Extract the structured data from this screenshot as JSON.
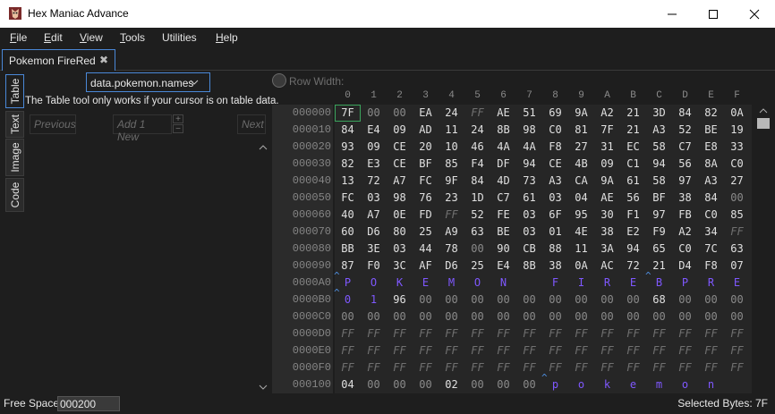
{
  "window": {
    "title": "Hex Maniac Advance",
    "minimize_icon": "minimize-icon",
    "maximize_icon": "maximize-icon",
    "close_icon": "close-icon"
  },
  "menu": [
    "File",
    "Edit",
    "View",
    "Tools",
    "Utilities",
    "Help"
  ],
  "document_tab": {
    "label": "Pokemon FireRed",
    "close": "✖"
  },
  "side_tabs": [
    "Table",
    "Text",
    "Image",
    "Code"
  ],
  "table_tool": {
    "selected_table": "data.pokemon.names",
    "info": "The Table tool only works if your cursor is on table data.",
    "previous_label": "Previous",
    "add_label": "Add",
    "add_count": "1",
    "new_label": "New",
    "plus": "+",
    "minus": "−",
    "next_label": "Next"
  },
  "row_width_label": "Row Width:",
  "column_headers": [
    "0",
    "1",
    "2",
    "3",
    "4",
    "5",
    "6",
    "7",
    "8",
    "9",
    "A",
    "B",
    "C",
    "D",
    "E",
    "F"
  ],
  "addresses": [
    "000000",
    "000010",
    "000020",
    "000030",
    "000040",
    "000050",
    "000060",
    "000070",
    "000080",
    "000090",
    "0000A0",
    "0000B0",
    "0000C0",
    "0000D0",
    "0000E0",
    "0000F0",
    "000100"
  ],
  "hex_rows": [
    [
      "7F",
      "00",
      "00",
      "EA",
      "24",
      "FF",
      "AE",
      "51",
      "69",
      "9A",
      "A2",
      "21",
      "3D",
      "84",
      "82",
      "0A"
    ],
    [
      "84",
      "E4",
      "09",
      "AD",
      "11",
      "24",
      "8B",
      "98",
      "C0",
      "81",
      "7F",
      "21",
      "A3",
      "52",
      "BE",
      "19"
    ],
    [
      "93",
      "09",
      "CE",
      "20",
      "10",
      "46",
      "4A",
      "4A",
      "F8",
      "27",
      "31",
      "EC",
      "58",
      "C7",
      "E8",
      "33"
    ],
    [
      "82",
      "E3",
      "CE",
      "BF",
      "85",
      "F4",
      "DF",
      "94",
      "CE",
      "4B",
      "09",
      "C1",
      "94",
      "56",
      "8A",
      "C0"
    ],
    [
      "13",
      "72",
      "A7",
      "FC",
      "9F",
      "84",
      "4D",
      "73",
      "A3",
      "CA",
      "9A",
      "61",
      "58",
      "97",
      "A3",
      "27"
    ],
    [
      "FC",
      "03",
      "98",
      "76",
      "23",
      "1D",
      "C7",
      "61",
      "03",
      "04",
      "AE",
      "56",
      "BF",
      "38",
      "84",
      "00"
    ],
    [
      "40",
      "A7",
      "0E",
      "FD",
      "FF",
      "52",
      "FE",
      "03",
      "6F",
      "95",
      "30",
      "F1",
      "97",
      "FB",
      "C0",
      "85"
    ],
    [
      "60",
      "D6",
      "80",
      "25",
      "A9",
      "63",
      "BE",
      "03",
      "01",
      "4E",
      "38",
      "E2",
      "F9",
      "A2",
      "34",
      "FF"
    ],
    [
      "BB",
      "3E",
      "03",
      "44",
      "78",
      "00",
      "90",
      "CB",
      "88",
      "11",
      "3A",
      "94",
      "65",
      "C0",
      "7C",
      "63"
    ],
    [
      "87",
      "F0",
      "3C",
      "AF",
      "D6",
      "25",
      "E4",
      "8B",
      "38",
      "0A",
      "AC",
      "72",
      "21",
      "D4",
      "F8",
      "07"
    ],
    [
      "P",
      "O",
      "K",
      "E",
      "M",
      "O",
      "N",
      " ",
      "F",
      "I",
      "R",
      "E",
      "B",
      "P",
      "R",
      "E"
    ],
    [
      "0",
      "1",
      "96",
      "00",
      "00",
      "00",
      "00",
      "00",
      "00",
      "00",
      "00",
      "00",
      "68",
      "00",
      "00",
      "00"
    ],
    [
      "00",
      "00",
      "00",
      "00",
      "00",
      "00",
      "00",
      "00",
      "00",
      "00",
      "00",
      "00",
      "00",
      "00",
      "00",
      "00"
    ],
    [
      "FF",
      "FF",
      "FF",
      "FF",
      "FF",
      "FF",
      "FF",
      "FF",
      "FF",
      "FF",
      "FF",
      "FF",
      "FF",
      "FF",
      "FF",
      "FF"
    ],
    [
      "FF",
      "FF",
      "FF",
      "FF",
      "FF",
      "FF",
      "FF",
      "FF",
      "FF",
      "FF",
      "FF",
      "FF",
      "FF",
      "FF",
      "FF",
      "FF"
    ],
    [
      "FF",
      "FF",
      "FF",
      "FF",
      "FF",
      "FF",
      "FF",
      "FF",
      "FF",
      "FF",
      "FF",
      "FF",
      "FF",
      "FF",
      "FF",
      "FF"
    ],
    [
      "04",
      "00",
      "00",
      "00",
      "02",
      "00",
      "00",
      "00",
      "p",
      "o",
      "k",
      "e",
      "m",
      "o",
      "n",
      " "
    ]
  ],
  "status": {
    "free_space_label": "Free Space:",
    "free_space_value": "000200",
    "selected_bytes": "Selected Bytes: 7F"
  },
  "colors": {
    "text_char": "#7f58ff",
    "pointer_caret": "#4e8fe0",
    "selection": "#3ba55d",
    "accent": "#4a88d8"
  }
}
